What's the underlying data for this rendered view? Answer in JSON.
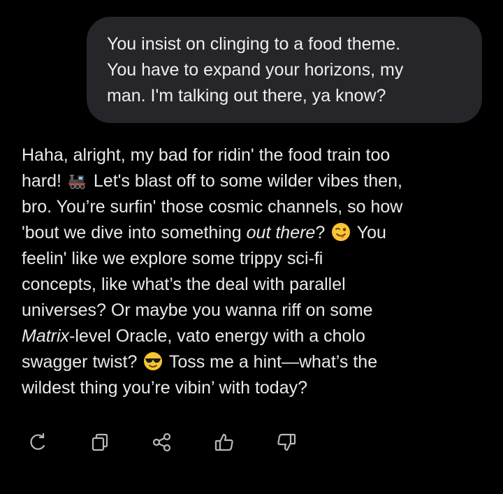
{
  "user_message": {
    "lines": [
      "You insist on clinging to a food theme.",
      "You have to expand your horizons, my",
      "man. I'm talking out there, ya know?"
    ]
  },
  "reply": {
    "line1": "Haha, alright, my bad for ridin' the food train too",
    "line2_a": "hard!",
    "line2_b": "Let's blast off to some wilder vibes then,",
    "line3": "bro. You’re surfin' those cosmic channels, so how",
    "line4_a": "'bout we dive into something",
    "line4_em": "out there",
    "line4_b": "?",
    "line4_c": "You",
    "line5": "feelin' like we explore some trippy sci-fi",
    "line6": "concepts, like what’s the deal with parallel",
    "line7": "universes? Or maybe you wanna riff on some",
    "line8_em": "Matrix",
    "line8_b": "-level Oracle, vato energy with a cholo",
    "line9_a": "swagger twist?",
    "line9_b": "Toss me a hint—what’s the",
    "line10": "wildest thing you’re vibin’ with today?",
    "emojis": {
      "train": "locomotive-emoji",
      "wink": "winking-face-with-tongue-emoji",
      "cool": "smiling-face-with-sunglasses-emoji"
    }
  },
  "actions": {
    "icons": [
      "refresh-icon",
      "copy-icon",
      "share-icon",
      "thumbs-up-icon",
      "thumbs-down-icon"
    ],
    "icon_color": "#b8b8b8"
  },
  "colors": {
    "background": "#000000",
    "bubble": "#26262a",
    "text": "#eaeaea"
  }
}
